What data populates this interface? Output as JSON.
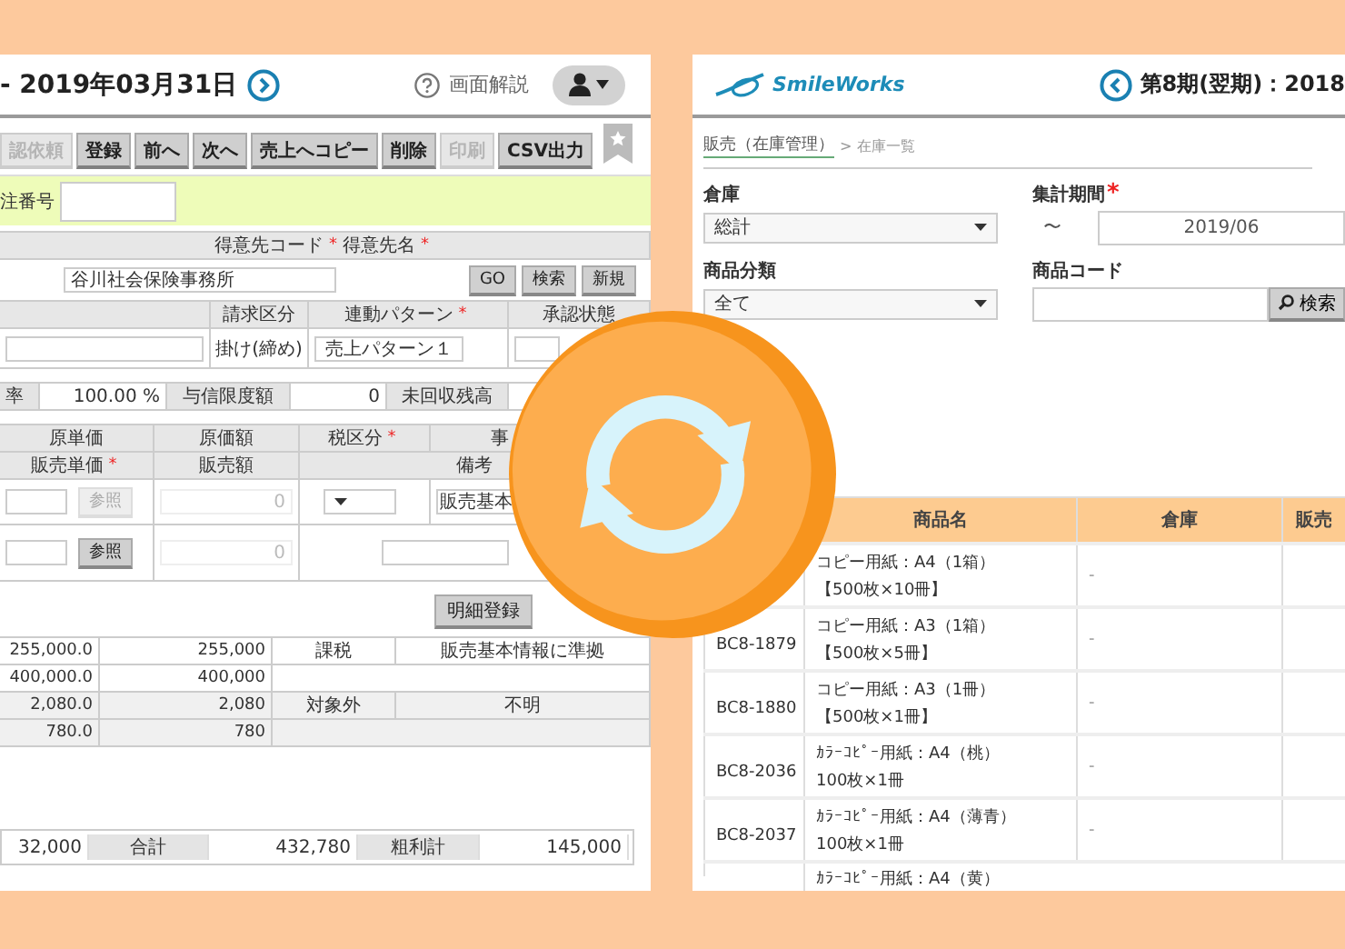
{
  "left_screen": {
    "date_heading": "- 2019年03月31日",
    "help_link": "画面解説",
    "toolbar": [
      {
        "label": "認依頼",
        "disabled": true
      },
      {
        "label": "登録",
        "disabled": false
      },
      {
        "label": "前へ",
        "disabled": false
      },
      {
        "label": "次へ",
        "disabled": false
      },
      {
        "label": "売上へコピー",
        "disabled": false
      },
      {
        "label": "削除",
        "disabled": false
      },
      {
        "label": "印刷",
        "disabled": true
      },
      {
        "label": "CSV出力",
        "disabled": false
      }
    ],
    "order_number_label": "注番号",
    "customer": {
      "code_label": "得意先コード",
      "code_mark": "*",
      "name_label": "得意先名",
      "name_mark": "*",
      "name_value": "谷川社会保険事務所",
      "buttons": [
        "GO",
        "検索",
        "新規"
      ]
    },
    "billing": {
      "labels": [
        {
          "text": "請求区分"
        },
        {
          "text": "連動パターン",
          "mark": "*"
        },
        {
          "text": "承認状態"
        }
      ],
      "billing_type": "掛け(締め)",
      "pattern": "売上パターン１"
    },
    "credit": {
      "rate_label": "率",
      "rate": "100.00 %",
      "limit_label": "与信限度額",
      "limit": "0",
      "balance_label": "未回収残高"
    },
    "detail_headers": [
      {
        "text": "原単価"
      },
      {
        "text": "原価額"
      },
      {
        "text": "税区分",
        "mark": "*"
      },
      {
        "text": "事"
      }
    ],
    "detail_headers_2": [
      {
        "text": "販売単価",
        "mark": "*"
      },
      {
        "text": "販売額"
      },
      {
        "text": "備考"
      }
    ],
    "entry_rows": [
      {
        "kind": "taxed",
        "button": "参照",
        "disabled": true,
        "amount": "0",
        "note": "販売基本"
      },
      {
        "kind": "plain",
        "button": "参照",
        "disabled": false,
        "amount": "0"
      }
    ],
    "register_button": "明細登録",
    "lines": [
      {
        "unit_price": "255,000.0",
        "amount": "255,000",
        "tax": "課税",
        "note": "販売基本情報に準拠",
        "shaded": false
      },
      {
        "unit_price": "400,000.0",
        "amount": "400,000",
        "shaded": false
      },
      {
        "unit_price": "2,080.0",
        "amount": "2,080",
        "tax": "対象外",
        "note": "不明",
        "shaded": true
      },
      {
        "unit_price": "780.0",
        "amount": "780",
        "shaded": true
      }
    ],
    "totals": {
      "value_1": "32,000",
      "total_label": "合計",
      "total": "432,780",
      "profit_label": "粗利計",
      "profit": "145,000"
    }
  },
  "right_screen": {
    "logo": "SmileWorks",
    "period": "第8期(翌期)：2018",
    "breadcrumb": {
      "link": "販売（在庫管理）",
      "separator": ">",
      "current": "在庫一覧"
    },
    "filters": [
      {
        "label": "倉庫",
        "kind": "select",
        "value": "総計"
      },
      {
        "label": "集計期間",
        "mark": "*",
        "kind": "range",
        "prefix": "〜",
        "value": "2019/06"
      },
      {
        "label": "商品分類",
        "kind": "select",
        "value": "全て"
      },
      {
        "label": "商品コード",
        "kind": "search",
        "button": "検索"
      }
    ],
    "table": {
      "columns": [
        "商品名",
        "倉庫",
        "販売"
      ],
      "rows": [
        {
          "name_lines": [
            "コピー用紙：A4（1箱）",
            "【500枚×10冊】"
          ],
          "warehouse": "-"
        },
        {
          "code": "BC8-1879",
          "name_lines": [
            "コピー用紙：A3（1箱）",
            "【500枚×5冊】"
          ],
          "warehouse": "-"
        },
        {
          "code": "BC8-1880",
          "name_lines": [
            "コピー用紙：A3（1冊）",
            "【500枚×1冊】"
          ],
          "warehouse": "-"
        },
        {
          "code": "BC8-2036",
          "name_lines": [
            "ｶﾗｰｺﾋﾟｰ用紙：A4（桃）",
            "100枚×1冊"
          ],
          "warehouse": "-"
        },
        {
          "code": "BC8-2037",
          "name_lines": [
            "ｶﾗｰｺﾋﾟｰ用紙：A4（薄青）",
            "100枚×1冊"
          ],
          "warehouse": "-"
        },
        {
          "name_lines": [
            "ｶﾗｰｺﾋﾟｰ用紙：A4（黄）"
          ]
        }
      ]
    }
  }
}
